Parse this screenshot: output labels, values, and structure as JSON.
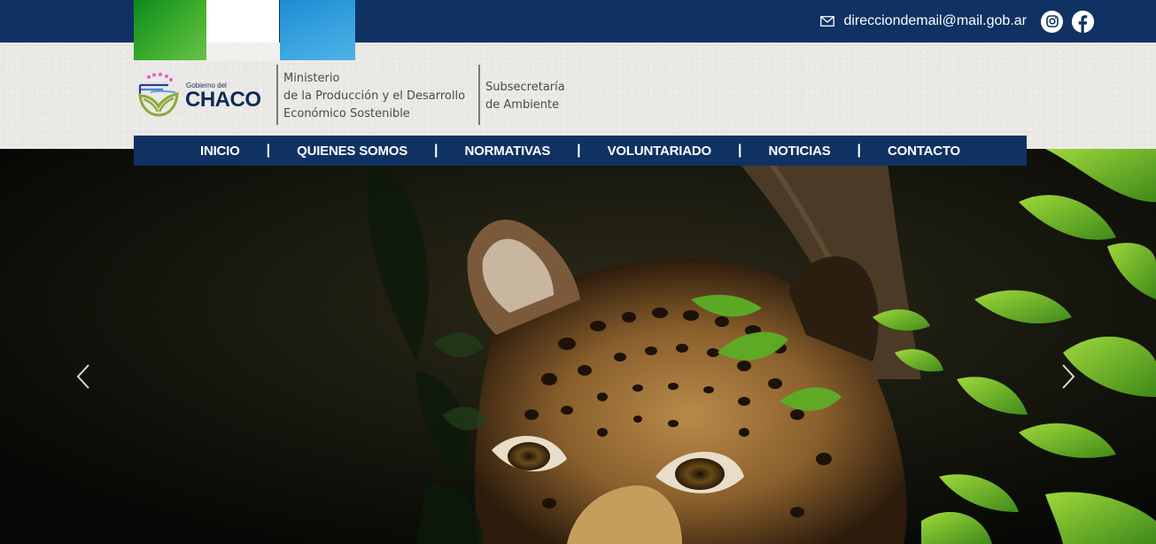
{
  "topbar": {
    "email": "direcciondemail@mail.gob.ar",
    "icons": [
      "mail-icon",
      "instagram-icon",
      "facebook-icon"
    ]
  },
  "logo": {
    "small_text": "Gobierno del",
    "big_text": "CHACO"
  },
  "ministry": {
    "lines": [
      "Ministerio",
      "de la Producción y el Desarrollo",
      "Económico Sostenible"
    ]
  },
  "subsecretaria": {
    "lines": [
      "Subsecretaría",
      "de Ambiente"
    ]
  },
  "nav": {
    "items": [
      {
        "label": "INICIO"
      },
      {
        "label": "QUIENES SOMOS"
      },
      {
        "label": "NORMATIVAS"
      },
      {
        "label": "VOLUNTARIADO"
      },
      {
        "label": "NOTICIAS"
      },
      {
        "label": "CONTACTO"
      }
    ],
    "separator": "|"
  },
  "colors": {
    "navy": "#0f3263",
    "flag_green": "#3fae2c",
    "flag_blue": "#2e9bd9"
  },
  "carousel": {
    "prev_icon": "chevron-left-icon",
    "next_icon": "chevron-right-icon"
  }
}
